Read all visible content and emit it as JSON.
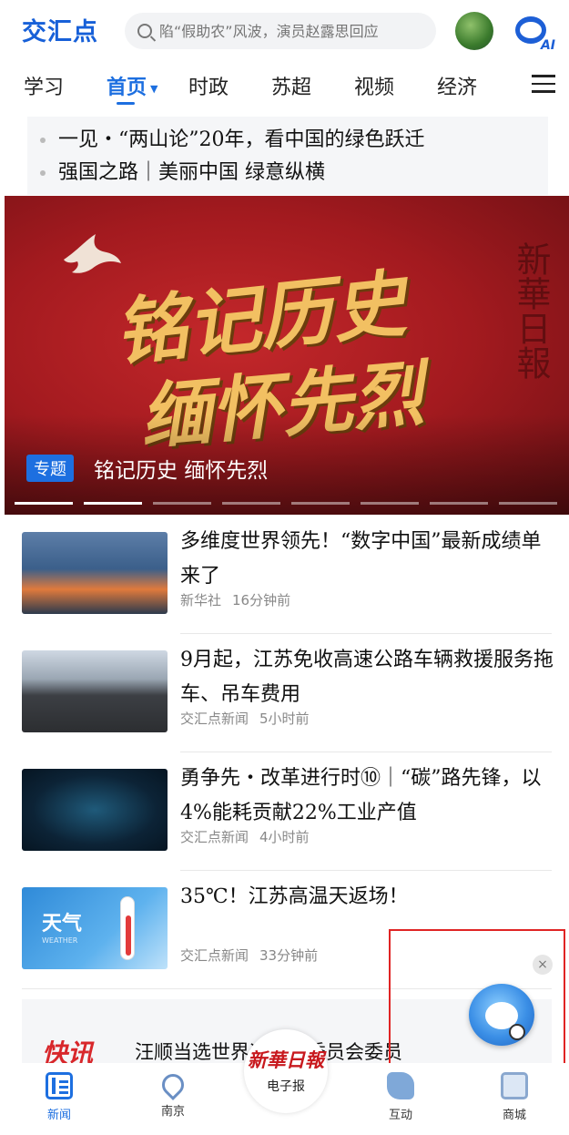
{
  "app": {
    "logo": "交汇点",
    "search_placeholder": "陷“假助农”风波，演员赵露思回应",
    "ai_label": "AI"
  },
  "nav": {
    "tabs": [
      {
        "label": "学习"
      },
      {
        "label": "首页",
        "active": true
      },
      {
        "label": "时政"
      },
      {
        "label": "苏超"
      },
      {
        "label": "视频"
      },
      {
        "label": "经济"
      }
    ],
    "caret": "▼"
  },
  "headlines": [
    "一见・“两山论”20年，看中国的绿色跃迁",
    "强国之路｜美丽中国 绿意纵横"
  ],
  "banner": {
    "calligraphy_line1": "铭记历史",
    "calligraphy_line2": "缅怀先烈",
    "background_text": "新華日報",
    "badge": "专题",
    "title": "铭记历史 缅怀先烈",
    "slide_count": 8,
    "active_slide": 2
  },
  "news": [
    {
      "title": "多维度世界领先！“数字中国”最新成绩单来了",
      "source": "新华社",
      "time": "16分钟前",
      "thumb": "lab-scientists-image"
    },
    {
      "title": "9月起，江苏免收高速公路车辆救援服务拖车、吊车费用",
      "source": "交汇点新闻",
      "time": "5小时前",
      "thumb": "highway-toll-image"
    },
    {
      "title": "勇争先・改革进行时⑩｜“碳”路先锋，以4%能耗贡献22%工业产值",
      "source": "交汇点新闻",
      "time": "4小时前",
      "thumb": "data-dashboard-image"
    },
    {
      "title": "35℃！江苏高温天返场！",
      "source": "交汇点新闻",
      "time": "33分钟前",
      "thumb": "weather-thermometer-image"
    }
  ],
  "weather_thumb": {
    "label": "天气",
    "sub": "WEATHER"
  },
  "flash": {
    "tag": "快讯",
    "text": "汪顺当选世界运动员委员会委员"
  },
  "floating": {
    "close": "×"
  },
  "bottom_nav": [
    {
      "label": "新闻",
      "active": true,
      "icon": "news-icon"
    },
    {
      "label": "南京",
      "icon": "location-pin-icon"
    },
    {
      "label": "电子报",
      "logo": "新華日報",
      "icon": "newspaper-logo"
    },
    {
      "label": "互动",
      "icon": "interaction-icon"
    },
    {
      "label": "商城",
      "icon": "shop-icon"
    }
  ],
  "colors": {
    "brand_blue": "#1d6fe0",
    "banner_red": "#a31a1f",
    "flash_red": "#d8272b"
  }
}
